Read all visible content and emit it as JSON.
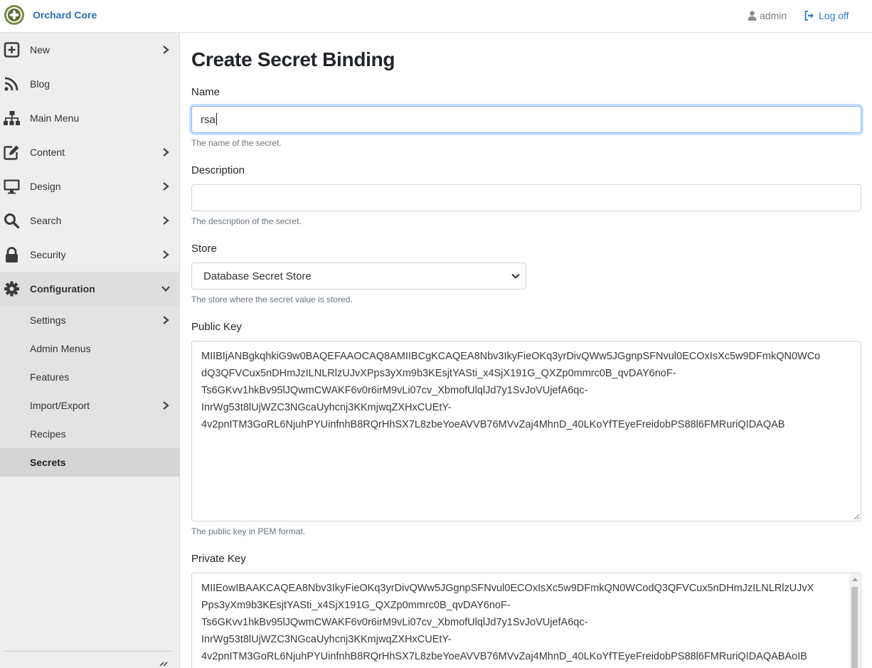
{
  "header": {
    "brand": "Orchard Core",
    "user": "admin",
    "logoff": "Log off"
  },
  "sidebar": {
    "items": [
      {
        "label": "New",
        "icon": "plus-square-icon"
      },
      {
        "label": "Blog",
        "icon": "rss-icon"
      },
      {
        "label": "Main Menu",
        "icon": "sitemap-icon"
      },
      {
        "label": "Content",
        "icon": "edit-icon"
      },
      {
        "label": "Design",
        "icon": "desktop-icon"
      },
      {
        "label": "Search",
        "icon": "search-icon"
      },
      {
        "label": "Security",
        "icon": "lock-icon"
      },
      {
        "label": "Configuration",
        "icon": "gear-icon"
      }
    ],
    "configuration_items": [
      {
        "label": "Settings"
      },
      {
        "label": "Admin Menus"
      },
      {
        "label": "Features"
      },
      {
        "label": "Import/Export"
      },
      {
        "label": "Recipes"
      },
      {
        "label": "Secrets"
      }
    ]
  },
  "form": {
    "title": "Create Secret Binding",
    "name": {
      "label": "Name",
      "value": "rsa",
      "hint": "The name of the secret."
    },
    "description": {
      "label": "Description",
      "value": "",
      "hint": "The description of the secret."
    },
    "store": {
      "label": "Store",
      "selected": "Database Secret Store",
      "hint": "The store where the secret value is stored."
    },
    "public_key": {
      "label": "Public Key",
      "lines": [
        "MIIBIjANBgkqhkiG9w0BAQEFAAOCAQ8AMIIBCgKCAQEA8Nbv3IkyFieOKq3yrDivQWw5JGgnpSFNvul0ECOxIsXc5w9DFmkQN0WCo",
        "dQ3QFVCux5nDHmJzILNLRlzUJvXPps3yXm9b3KEsjtYASti_x4SjX191G_QXZp0mmrc0B_qvDAY6noF-",
        "Ts6GKvv1hkBv95lJQwmCWAKF6v0r6irM9vLi07cv_XbmofUlqlJd7y1SvJoVUjefA6qc-",
        "InrWg53t8lUjWZC3NGcaUyhcnj3KKmjwqZXHxCUEtY-",
        "4v2pnITM3GoRL6NjuhPYUinfnhB8RQrHhSX7L8zbeYoeAVVB76MVvZaj4MhnD_40LKoYfTEyeFreidobPS88l6FMRuriQIDAQAB"
      ],
      "hint": "The public key in PEM format."
    },
    "private_key": {
      "label": "Private Key",
      "lines": [
        "MIIEowIBAAKCAQEA8Nbv3IkyFieOKq3yrDivQWw5JGgnpSFNvul0ECOxIsXc5w9DFmkQN0WCodQ3QFVCux5nDHmJzILNLRlzUJvX",
        "Pps3yXm9b3KEsjtYASti_x4SjX191G_QXZp0mmrc0B_qvDAY6noF-",
        "Ts6GKvv1hkBv95lJQwmCWAKF6v0r6irM9vLi07cv_XbmofUlqlJd7y1SvJoVUjefA6qc-",
        "InrWg53t8lUjWZC3NGcaUyhcnj3KKmjwqZXHxCUEtY-",
        "4v2pnITM3GoRL6NjuhPYUinfnhB8RQrHhSX7L8zbeYoeAVVB76MVvZaj4MhnD_40LKoYfTEyeFreidobPS88l6FMRuriQIDAQABAoIB"
      ]
    }
  },
  "colors": {
    "link": "#2a7bd0",
    "sidebar_bg": "#eeeeee",
    "focus_ring": "#86b7fe"
  }
}
